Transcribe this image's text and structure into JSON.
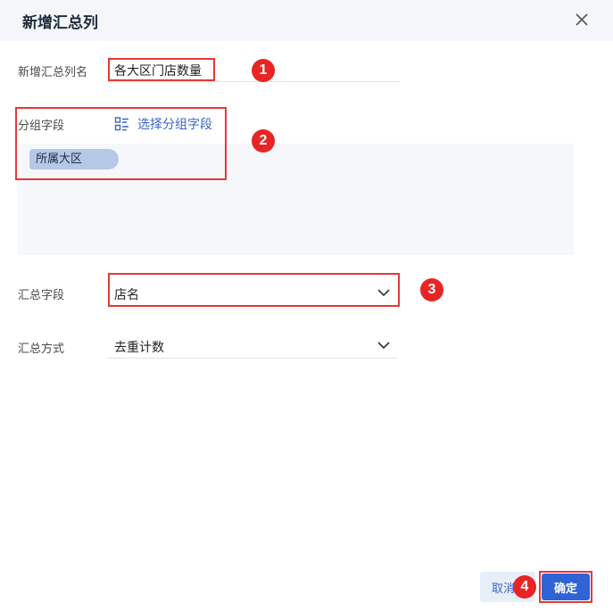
{
  "dialog": {
    "title": "新增汇总列",
    "close_icon": "close-icon"
  },
  "form": {
    "name_label": "新增汇总列名",
    "name_value": "各大区门店数量",
    "group_label": "分组字段",
    "group_select_label": "选择分组字段",
    "group_select_icon": "list-select-icon",
    "group_chips": [
      "所属大区"
    ],
    "agg_field_label": "汇总字段",
    "agg_field_value": "店名",
    "agg_method_label": "汇总方式",
    "agg_method_value": "去重计数",
    "dropdown_icon": "chevron-down-icon"
  },
  "annotations": [
    "1",
    "2",
    "3",
    "4"
  ],
  "footer": {
    "cancel_label": "取消",
    "ok_label": "确定"
  },
  "colors": {
    "accent": "#2f63d6",
    "highlight": "#e53935",
    "chip": "#b6c8e8",
    "header_bg": "#f5f6f9"
  }
}
